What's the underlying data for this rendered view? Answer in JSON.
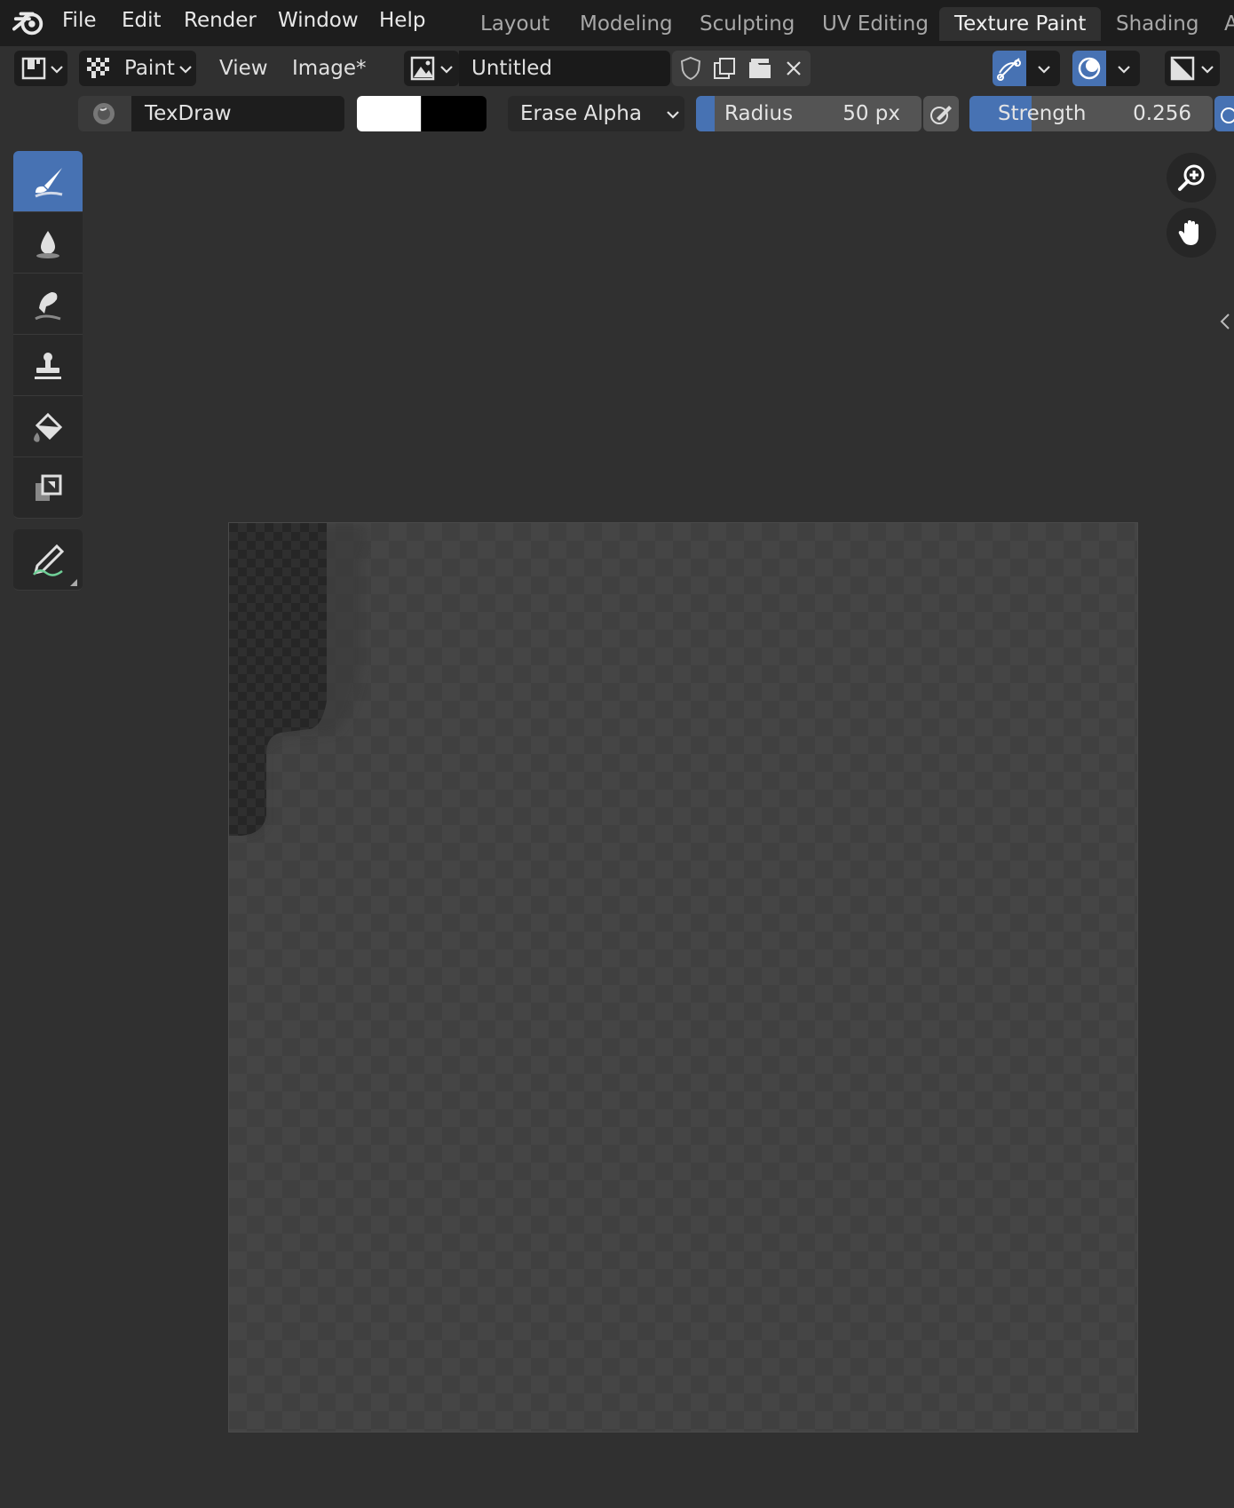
{
  "menubar": {
    "items": [
      "File",
      "Edit",
      "Render",
      "Window",
      "Help"
    ],
    "workspaces": [
      "Layout",
      "Modeling",
      "Sculpting",
      "UV Editing",
      "Texture Paint",
      "Shading",
      "A"
    ],
    "active_workspace": "Texture Paint"
  },
  "header": {
    "mode": "Paint",
    "view_menu": "View",
    "image_menu": "Image*",
    "image_name": "Untitled"
  },
  "tool_settings": {
    "brush_name": "TexDraw",
    "blend_mode": "Erase Alpha",
    "radius_label": "Radius",
    "radius_value": "50 px",
    "strength_label": "Strength",
    "strength_value": "0.256",
    "strength_fraction": 0.256,
    "primary_color": "#ffffff",
    "secondary_color": "#000000"
  },
  "toolbar": {
    "tools": [
      "draw-tool",
      "soften-tool",
      "smear-tool",
      "clone-tool",
      "fill-tool",
      "mask-tool",
      "annotate-tool"
    ],
    "active_tool": "draw-tool"
  },
  "colors": {
    "accent": "#4772b3",
    "background": "#303030",
    "panel": "#1d1d1d"
  }
}
